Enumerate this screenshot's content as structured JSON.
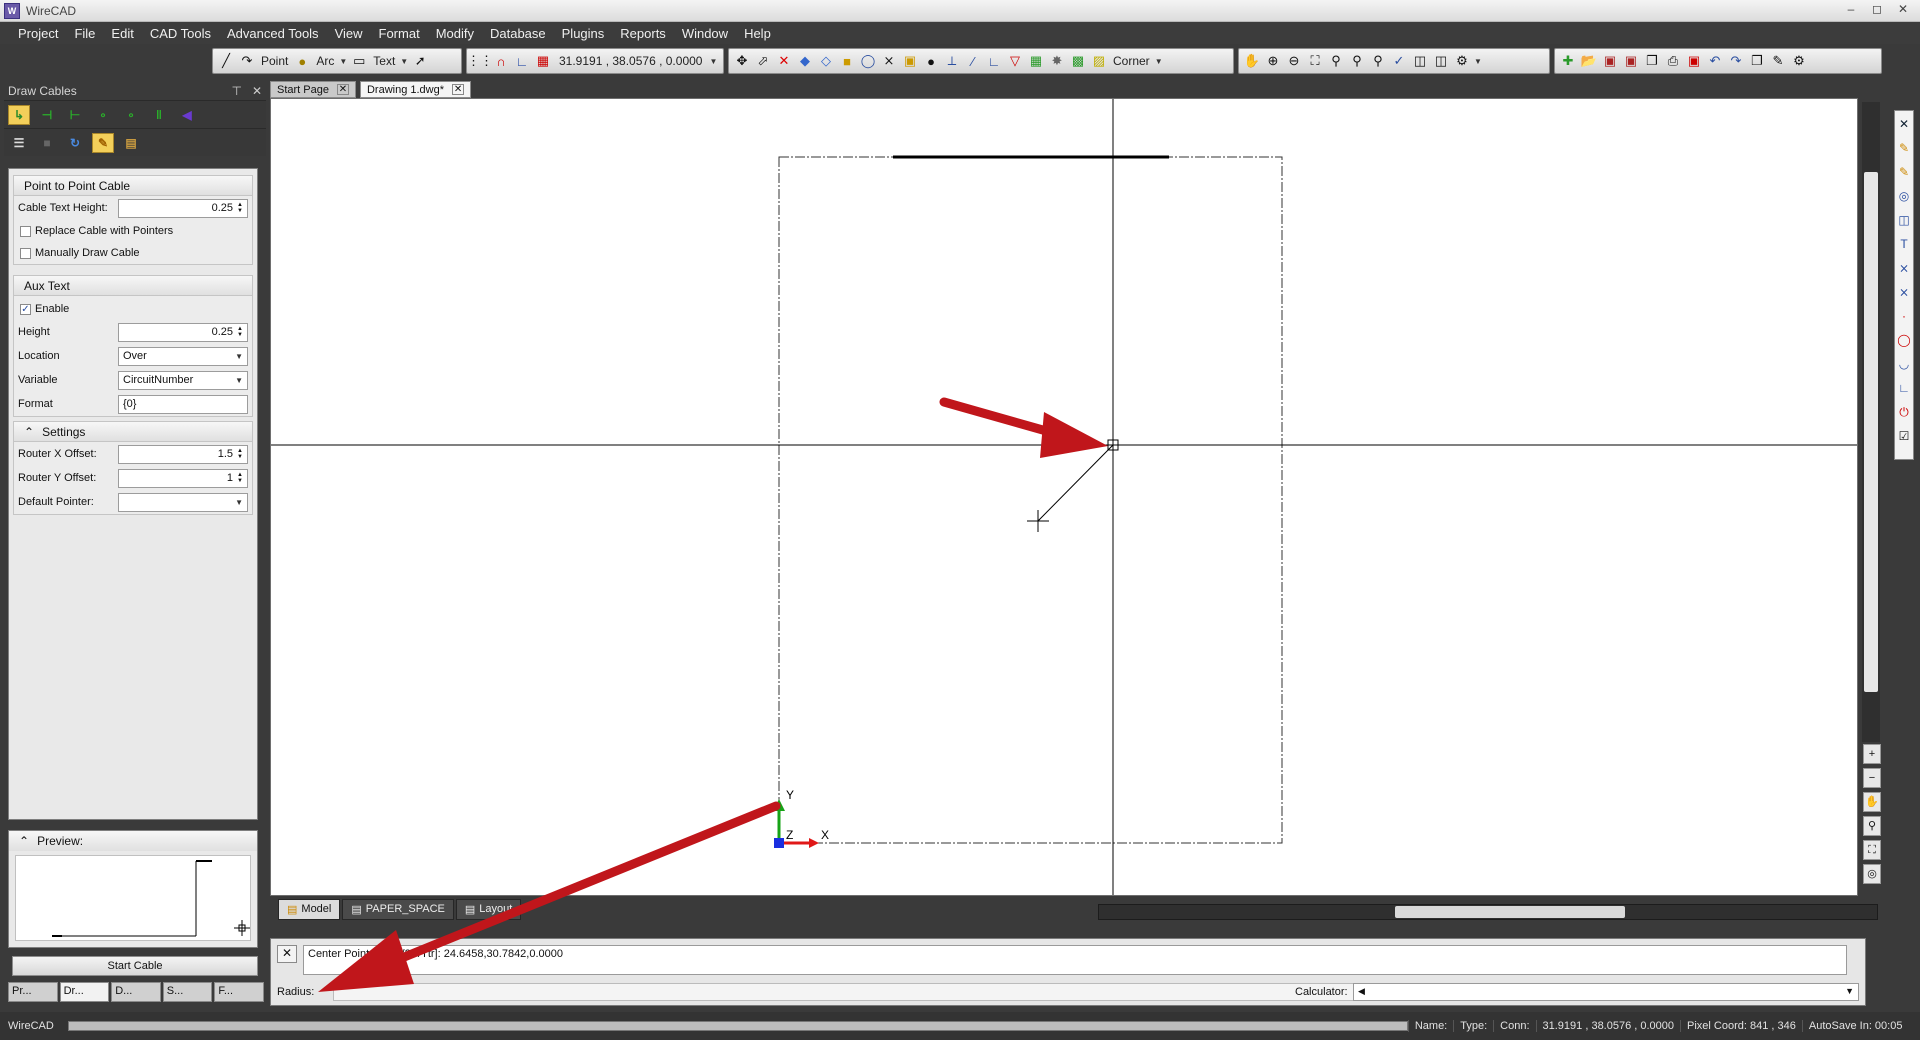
{
  "window": {
    "title": "WireCAD",
    "icon_text": "W"
  },
  "menu": [
    "Project",
    "File",
    "Edit",
    "CAD Tools",
    "Advanced Tools",
    "View",
    "Format",
    "Modify",
    "Database",
    "Plugins",
    "Reports",
    "Window",
    "Help"
  ],
  "toolbar": {
    "point_label": "Point",
    "arc_label": "Arc",
    "text_label": "Text",
    "coord_readout": "31.9191 , 38.0576 , 0.0000",
    "corner_label": "Corner"
  },
  "left_panel": {
    "title": "Draw Cables",
    "point_to_point": {
      "title": "Point to Point Cable",
      "cable_text_height_label": "Cable Text Height:",
      "cable_text_height": "0.25",
      "replace_cable_label": "Replace Cable with Pointers",
      "manually_draw_label": "Manually Draw Cable"
    },
    "aux_text": {
      "title": "Aux Text",
      "enable_label": "Enable",
      "enable_checked": "✓",
      "height_label": "Height",
      "height": "0.25",
      "location_label": "Location",
      "location": "Over",
      "variable_label": "Variable",
      "variable": "CircuitNumber",
      "format_label": "Format",
      "format": "{0}"
    },
    "settings": {
      "title": "Settings",
      "router_x_label": "Router X Offset:",
      "router_x": "1.5",
      "router_y_label": "Router Y Offset:",
      "router_y": "1",
      "default_pointer_label": "Default Pointer:",
      "default_pointer": ""
    },
    "preview_label": "Preview:",
    "start_cable": "Start Cable",
    "bottom_tabs": [
      "Pr...",
      "Dr...",
      "D...",
      "S...",
      "F..."
    ]
  },
  "doc_tabs": [
    {
      "label": "Start Page"
    },
    {
      "label": "Drawing 1.dwg*"
    }
  ],
  "drawing": {
    "axis_y": "Y",
    "axis_x": "X",
    "axis_z": "Z"
  },
  "layout_tabs": [
    "Model",
    "PAPER_SPACE",
    "Layout"
  ],
  "command": {
    "history_line": "Center Point or [3P/2P/Ttr]: 24.6458,30.7842,0.0000",
    "history_line_visible": "Center Point or [3P/2P/Ttr]: 24.6458,30.7842,0.0000",
    "prompt_label": "Radius:",
    "calculator_label": "Calculator:"
  },
  "status": {
    "app_name": "WireCAD",
    "name_label": "Name:",
    "type_label": "Type:",
    "conn_label": "Conn:",
    "coords": "31.9191 , 38.0576 , 0.0000",
    "pixel_coord": "Pixel Coord: 841 , 346",
    "autosave": "AutoSave In: 00:05"
  },
  "colors": {
    "dark_chrome": "#3a3a3a",
    "annotation_arrow": "#c0161b",
    "active_tool": "#f3cf5a",
    "axis_y": "#17a317",
    "axis_x": "#e01818",
    "axis_z": "#1a2ee0"
  }
}
